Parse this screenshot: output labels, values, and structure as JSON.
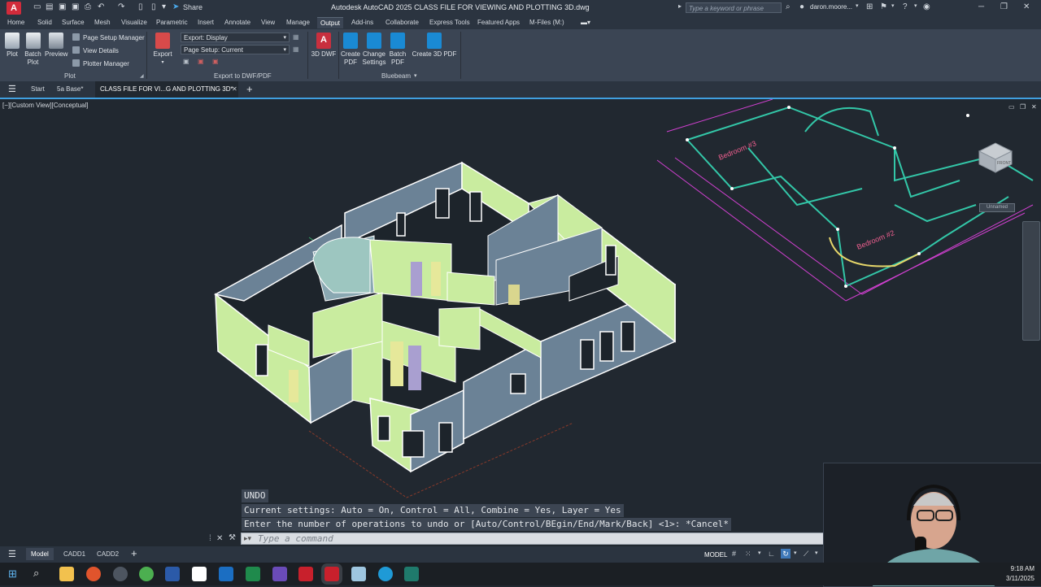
{
  "titlebar": {
    "app_icon": "A",
    "share_label": "Share",
    "title": "Autodesk AutoCAD 2025    CLASS FILE FOR VIEWING AND PLOTTING 3D.dwg",
    "search_placeholder": "Type a keyword or phrase",
    "user": "daron.moore..."
  },
  "ribbon_tabs": [
    "Home",
    "Solid",
    "Surface",
    "Mesh",
    "Visualize",
    "Parametric",
    "Insert",
    "Annotate",
    "View",
    "Manage",
    "Output",
    "Add-ins",
    "Collaborate",
    "Express Tools",
    "Featured Apps",
    "M-Files (M:)"
  ],
  "active_ribbon_tab": "Output",
  "ribbon": {
    "plot": {
      "label": "Plot"
    },
    "batch_plot": {
      "label": "Batch Plot"
    },
    "preview": {
      "label": "Preview"
    },
    "page_setup_manager": "Page Setup Manager",
    "view_details": "View Details",
    "plotter_manager": "Plotter Manager",
    "plot_panel": "Plot",
    "export": {
      "label": "Export"
    },
    "export_display": "Export: Display",
    "page_setup_current": "Page Setup: Current",
    "export_panel": "Export to DWF/PDF",
    "dwf3d": {
      "label": "3D DWF"
    },
    "create_pdf": {
      "label": "Create PDF"
    },
    "change_settings": {
      "label": "Change Settings"
    },
    "batch_pdf": {
      "label": "Batch PDF"
    },
    "create_3d_pdf": {
      "label": "Create 3D PDF"
    },
    "bluebeam_panel": "Bluebeam"
  },
  "file_tabs": [
    "Start",
    "5a Base*",
    "CLASS FILE FOR VI...G AND PLOTTING 3D*"
  ],
  "viewport_label": "[−][Custom View][Conceptual]",
  "drawing": {
    "bedroom3": "Bedroom #3",
    "bedroom2": "Bedroom #2",
    "viewcube_front": "FRONT",
    "viewcube_wcs": "Unnamed"
  },
  "command_history": [
    "UNDO",
    "Current settings: Auto = On, Control = All, Combine = Yes, Layer = Yes",
    "Enter the number of operations to undo or [Auto/Control/BEgin/End/Mark/Back] <1>: *Cancel*"
  ],
  "command_placeholder": "Type a command",
  "layout_tabs": [
    "Model",
    "CADD1",
    "CADD2"
  ],
  "status": {
    "model": "MODEL"
  },
  "clock": {
    "time": "9:18 AM",
    "date": "3/11/2025"
  },
  "colors": {
    "accent": "#40a0e0",
    "wall_green": "#c9ec9f",
    "wall_blue": "#6b8296",
    "plan_teal": "#33c7a8",
    "plan_magenta": "#d040d0"
  }
}
